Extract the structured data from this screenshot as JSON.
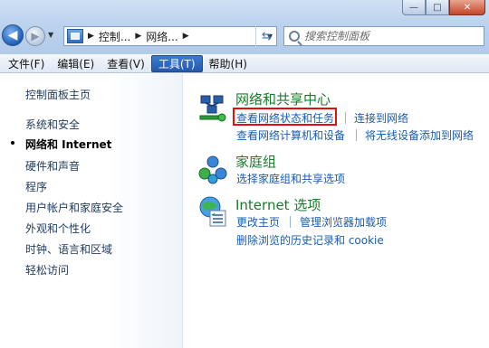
{
  "window": {
    "controls": {
      "minimize": "—",
      "maximize": "□",
      "close": "✕"
    }
  },
  "navigation": {
    "back_icon": "back-arrow-icon",
    "forward_icon": "forward-arrow-icon"
  },
  "address_bar": {
    "crumbs": [
      "控制...",
      "网络..."
    ]
  },
  "search": {
    "placeholder": "搜索控制面板"
  },
  "menu": {
    "items": [
      {
        "label": "文件(F)"
      },
      {
        "label": "编辑(E)"
      },
      {
        "label": "查看(V)"
      },
      {
        "label": "工具(T)",
        "active": true
      },
      {
        "label": "帮助(H)"
      }
    ]
  },
  "left_pane": {
    "home": "控制面板主页",
    "items": [
      "系统和安全",
      "网络和 Internet",
      "硬件和声音",
      "程序",
      "用户帐户和家庭安全",
      "外观和个性化",
      "时钟、语言和区域",
      "轻松访问"
    ],
    "current_index": 1
  },
  "categories": {
    "network": {
      "title": "网络和共享中心",
      "links": [
        "查看网络状态和任务",
        "连接到网络",
        "查看网络计算机和设备",
        "将无线设备添加到网络"
      ]
    },
    "homegroup": {
      "title": "家庭组",
      "links": [
        "选择家庭组和共享选项"
      ]
    },
    "internet_options": {
      "title": "Internet 选项",
      "links": [
        "更改主页",
        "管理浏览器加载项",
        "删除浏览的历史记录和 cookie"
      ]
    }
  },
  "colors": {
    "highlight_box": "#e01010",
    "link": "#1a5dae",
    "category_title": "#1c7a2d"
  }
}
